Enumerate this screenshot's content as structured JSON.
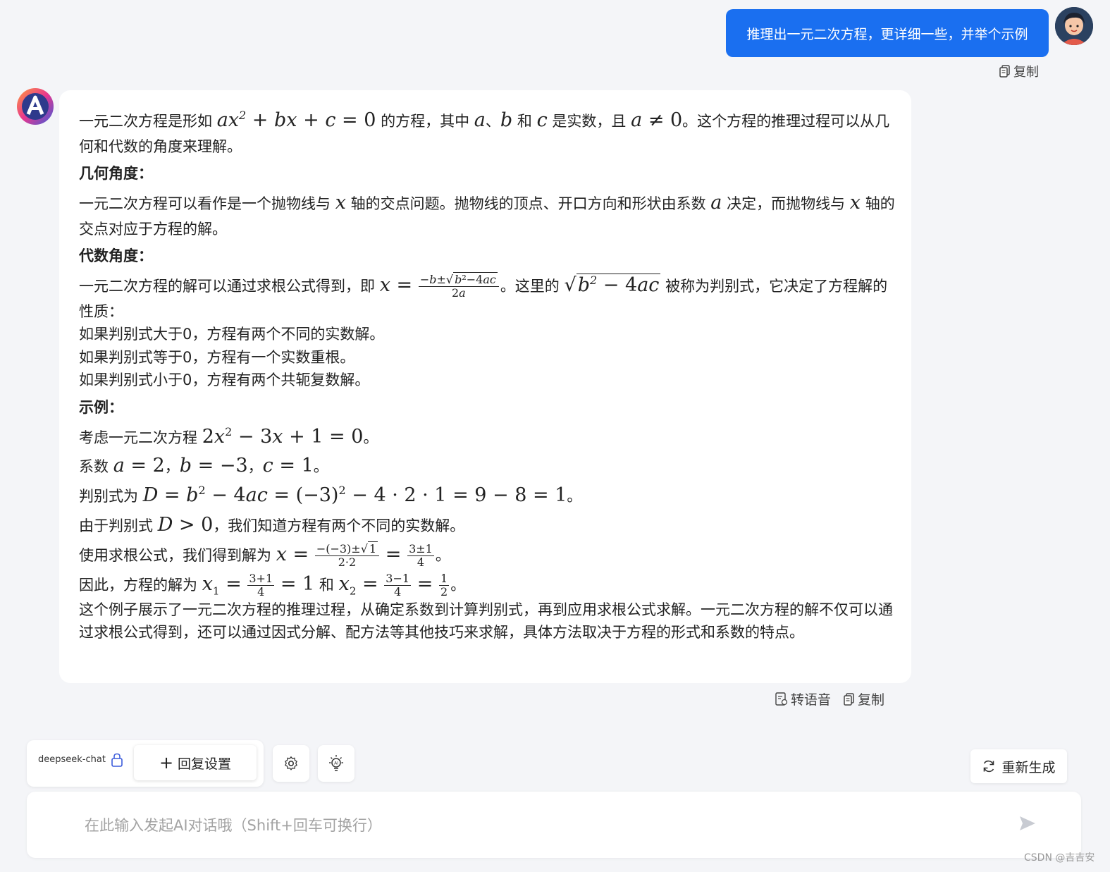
{
  "user_message": {
    "text": "推理出一元二次方程，更详细一些，并举个示例",
    "copy_label": "复制"
  },
  "ai_message": {
    "intro_1": "一元二次方程是形如",
    "intro_2": "的方程，其中",
    "intro_3": "是实数，且",
    "intro_4": "。这个方程的推理过程可以从几何和代数的角度来理解。",
    "h_geometry": "几何角度：",
    "geo_1": "一元二次方程可以看作是一个抛物线与",
    "geo_2": "轴的交点问题。抛物线的顶点、开口方向和形状由系数",
    "geo_3": "决定，而抛物线与",
    "geo_4": "轴的交点对应于方程的解。",
    "h_algebra": "代数角度：",
    "alg_1": "一元二次方程的解可以通过求根公式得到，即",
    "alg_2": "。这里的",
    "alg_3": "被称为判别式，它决定了方程解的性质：",
    "case_1": "如果判别式大于0，方程有两个不同的实数解。",
    "case_2": "如果判别式等于0，方程有一个实数重根。",
    "case_3": "如果判别式小于0，方程有两个共轭复数解。",
    "h_example": "示例：",
    "ex_1": "考虑一元二次方程",
    "ex_2": "系数",
    "ex_3": "判别式为",
    "ex_4a": "由于判别式",
    "ex_4b": "，我们知道方程有两个不同的实数解。",
    "ex_5": "使用求根公式，我们得到解为",
    "ex_6a": "因此，方程的解为",
    "ex_6b": "和",
    "conclusion": "这个例子展示了一元二次方程的推理过程，从确定系数到计算判别式，再到应用求根公式求解。一元二次方程的解不仅可以通过求根公式得到，还可以通过因式分解、配方法等其他技巧来求解，具体方法取决于方程的形式和系数的特点。",
    "tts_label": "转语音",
    "copy_label": "复制"
  },
  "toolbar": {
    "model_name": "deepseek-chat",
    "reply_settings_label": "回复设置",
    "regenerate_label": "重新生成"
  },
  "input": {
    "placeholder": "在此输入发起AI对话哦（Shift+回车可换行）",
    "value": ""
  },
  "watermark": "CSDN @吉吉安",
  "colors": {
    "accent": "#1a6ff0",
    "background": "#f4f5f8"
  }
}
